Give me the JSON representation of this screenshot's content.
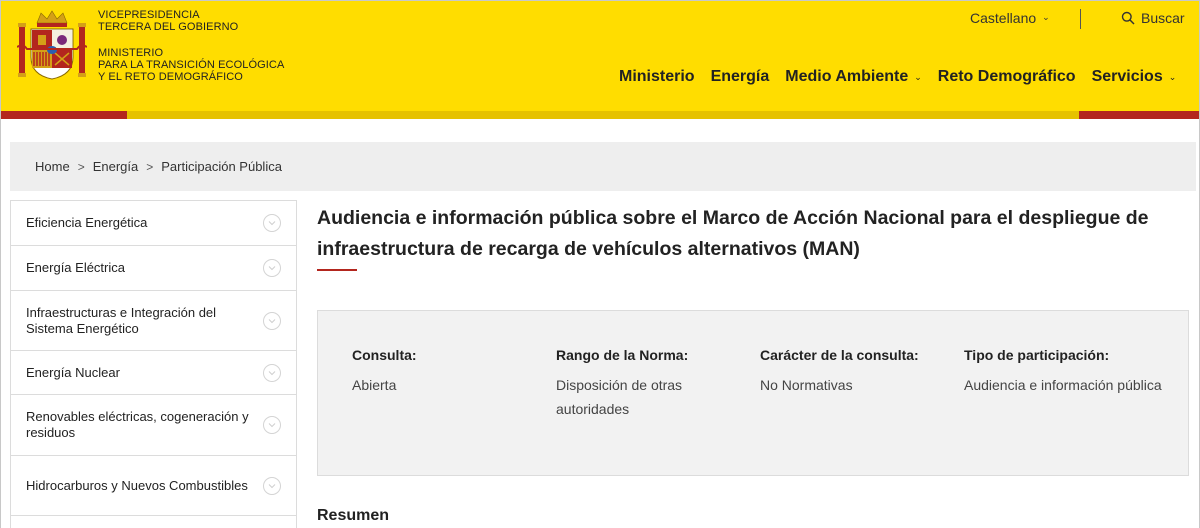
{
  "header": {
    "org_line1": "Vicepresidencia",
    "org_line2": "Tercera del Gobierno",
    "org_line3": "Ministerio",
    "org_line4": "para la Transición Ecológica",
    "org_line5": "y el Reto Demográfico",
    "language": "Castellano",
    "search_label": "Buscar",
    "colors": {
      "yellow": "#ffdd00",
      "red": "#b3261e"
    }
  },
  "nav": {
    "items": [
      {
        "label": "Ministerio"
      },
      {
        "label": "Energía"
      },
      {
        "label": "Medio Ambiente"
      },
      {
        "label": "Reto Demográfico"
      },
      {
        "label": "Servicios"
      }
    ]
  },
  "breadcrumb": {
    "items": [
      "Home",
      "Energía",
      "Participación Pública"
    ],
    "separator": ">"
  },
  "sidebar": {
    "items": [
      {
        "label": "Eficiencia Energética"
      },
      {
        "label": "Energía Eléctrica"
      },
      {
        "label": "Infraestructuras e Integración del Sistema Energético"
      },
      {
        "label": "Energía Nuclear"
      },
      {
        "label": "Renovables eléctricas, cogeneración y residuos"
      },
      {
        "label": "Hidrocarburos y Nuevos Combustibles"
      }
    ]
  },
  "main": {
    "title": "Audiencia e información pública sobre el Marco de Acción Nacional para el despliegue de infraestructura de recarga de vehículos alternativos (MAN)",
    "info": [
      {
        "label": "Consulta:",
        "value": "Abierta"
      },
      {
        "label": "Rango de la Norma:",
        "value": "Disposición de otras autoridades"
      },
      {
        "label": "Carácter de la consulta:",
        "value": "No Normativas"
      },
      {
        "label": "Tipo de participación:",
        "value": "Audiencia e información pública"
      }
    ],
    "section_heading": "Resumen"
  }
}
